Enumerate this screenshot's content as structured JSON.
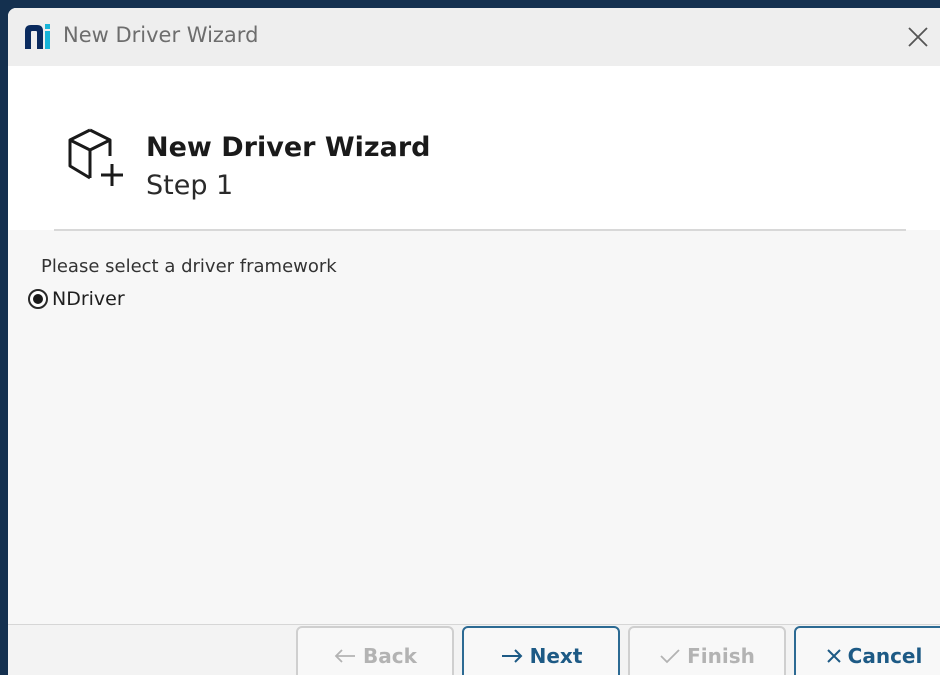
{
  "window": {
    "title": "New Driver Wizard"
  },
  "header": {
    "title": "New Driver Wizard",
    "step": "Step 1"
  },
  "content": {
    "prompt": "Please select a driver framework",
    "options": [
      {
        "label": "NDriver",
        "selected": true
      }
    ]
  },
  "buttons": {
    "back": "Back",
    "next": "Next",
    "finish": "Finish",
    "cancel": "Cancel"
  },
  "colors": {
    "logo_dark": "#0a2a5e",
    "logo_cyan": "#18b4d8",
    "accent": "#1d5a85"
  }
}
